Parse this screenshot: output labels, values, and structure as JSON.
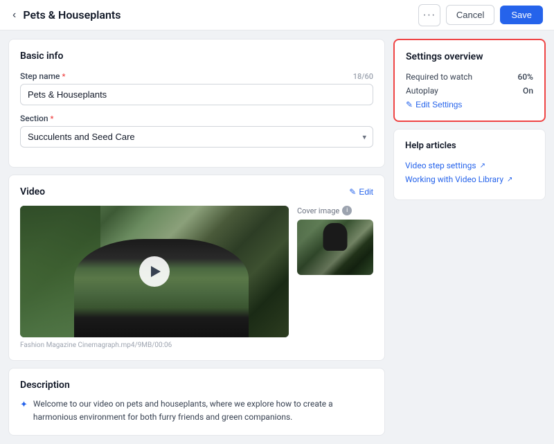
{
  "header": {
    "title": "Pets & Houseplants",
    "back_label": "‹",
    "dots_label": "···",
    "cancel_label": "Cancel",
    "save_label": "Save"
  },
  "basic_info": {
    "section_title": "Basic info",
    "step_name_label": "Step name",
    "step_name_value": "Pets & Houseplants",
    "step_name_char_count": "18/60",
    "section_label": "Section",
    "section_value": "Succulents and Seed Care"
  },
  "video": {
    "section_title": "Video",
    "edit_label": "Edit",
    "caption": "Fashion Magazine Cinemagraph.mp4/9MB/00:06",
    "cover_image_label": "Cover image"
  },
  "description": {
    "section_title": "Description",
    "text": "Welcome to our video on pets and houseplants, where we explore how to create a harmonious environment for both furry friends and green companions."
  },
  "settings_overview": {
    "title": "Settings overview",
    "required_label": "Required to watch",
    "required_value": "60%",
    "autoplay_label": "Autoplay",
    "autoplay_value": "On",
    "edit_label": "Edit Settings"
  },
  "help_articles": {
    "title": "Help articles",
    "links": [
      {
        "label": "Video step settings"
      },
      {
        "label": "Working with Video Library"
      }
    ]
  }
}
